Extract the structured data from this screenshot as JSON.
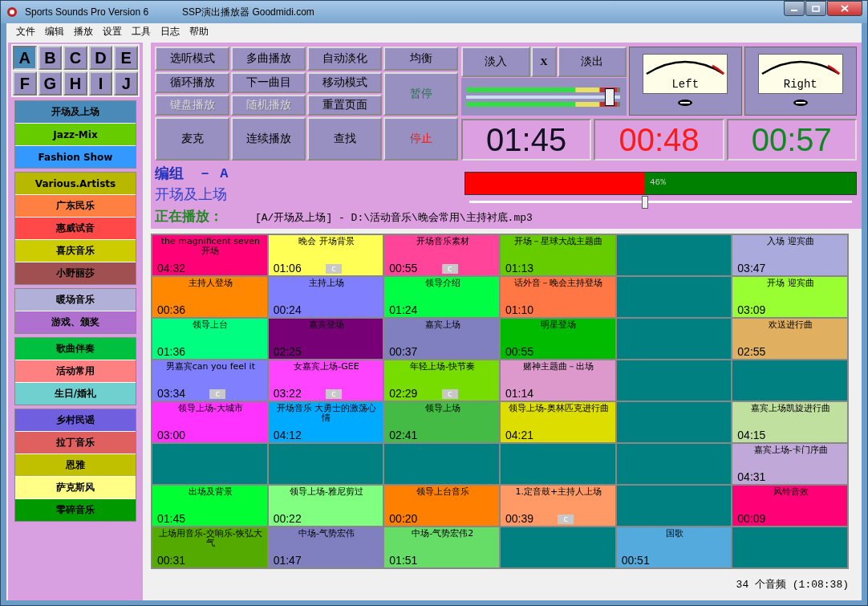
{
  "window": {
    "title": "Sports Sounds Pro Version 6",
    "subtitle": "SSP演出播放器 Goodmidi.com"
  },
  "menu": [
    "文件",
    "编辑",
    "播放",
    "设置",
    "工具",
    "日志",
    "帮助"
  ],
  "letters": [
    {
      "label": "A",
      "selected": true
    },
    {
      "label": "B",
      "selected": false
    },
    {
      "label": "C",
      "selected": false
    },
    {
      "label": "D",
      "selected": false
    },
    {
      "label": "E",
      "selected": false
    },
    {
      "label": "F",
      "selected": false
    },
    {
      "label": "G",
      "selected": false
    },
    {
      "label": "H",
      "selected": false
    },
    {
      "label": "I",
      "selected": false
    },
    {
      "label": "J",
      "selected": false
    }
  ],
  "category_groups": [
    [
      {
        "label": "开场及上场",
        "color": "#4a8ab8"
      },
      {
        "label": "Jazz-Mix",
        "color": "#66cc00"
      },
      {
        "label": "Fashion Show",
        "color": "#3399ff"
      }
    ],
    [
      {
        "label": "Various.Artists",
        "color": "#b8b800"
      },
      {
        "label": "广东民乐",
        "color": "#ff8040"
      },
      {
        "label": "惠威试音",
        "color": "#ff4848"
      },
      {
        "label": "喜庆音乐",
        "color": "#cccc00"
      },
      {
        "label": "小野丽莎",
        "color": "#a05050"
      }
    ],
    [
      {
        "label": "暖场音乐",
        "color": "#b0b0d8"
      },
      {
        "label": "游戏、颁奖",
        "color": "#b070d0"
      }
    ],
    [
      {
        "label": "歌曲伴奏",
        "color": "#00c040"
      },
      {
        "label": "活动常用",
        "color": "#ff8080"
      },
      {
        "label": "生日/婚礼",
        "color": "#70d0d0"
      }
    ],
    [
      {
        "label": "乡村民谣",
        "color": "#7060e0"
      },
      {
        "label": "拉丁音乐",
        "color": "#e06060"
      },
      {
        "label": "恩雅",
        "color": "#c0c000"
      },
      {
        "label": "萨克斯风",
        "color": "#ffff88"
      },
      {
        "label": "零碎音乐",
        "color": "#009900"
      }
    ]
  ],
  "controls": [
    {
      "label": "选听模式",
      "kind": "normal",
      "disabled": false
    },
    {
      "label": "多曲播放",
      "kind": "normal",
      "disabled": false
    },
    {
      "label": "自动淡化",
      "kind": "normal",
      "disabled": false
    },
    {
      "label": "均衡",
      "kind": "normal",
      "disabled": false
    },
    {
      "label": "循环播放",
      "kind": "normal",
      "disabled": false
    },
    {
      "label": "下一曲目",
      "kind": "normal",
      "disabled": false
    },
    {
      "label": "移动模式",
      "kind": "normal",
      "disabled": false
    },
    {
      "label": "暂停",
      "kind": "pause",
      "disabled": false
    },
    {
      "label": "键盘播放",
      "kind": "normal",
      "disabled": true
    },
    {
      "label": "随机播放",
      "kind": "normal",
      "disabled": true
    },
    {
      "label": "重置页面",
      "kind": "normal",
      "disabled": false
    },
    {
      "label": "麦克",
      "kind": "big",
      "disabled": false
    },
    {
      "label": "连续播放",
      "kind": "big",
      "disabled": false
    },
    {
      "label": "查找",
      "kind": "big",
      "disabled": false
    },
    {
      "label": "停止",
      "kind": "stop",
      "disabled": false
    }
  ],
  "fade": {
    "fade_in": "淡入",
    "cross": "X",
    "fade_out": "淡出"
  },
  "level_meters": [
    {
      "level": 0.98
    },
    {
      "level": 0.98
    }
  ],
  "volume": {
    "level": 0.93
  },
  "vu_meters": [
    {
      "label": "Left"
    },
    {
      "label": "Right"
    }
  ],
  "times": [
    {
      "value": "01:45",
      "kind": "total"
    },
    {
      "value": "00:48",
      "kind": "elapsed"
    },
    {
      "value": "00:57",
      "kind": "remaining"
    }
  ],
  "group_label": "编组",
  "group_letter": "－ A",
  "category_name": "开场及上场",
  "progress": {
    "level": 0.46,
    "label": "46%"
  },
  "seek": {
    "level": 0.46
  },
  "now_playing": {
    "label": "正在播放：",
    "path": "[A/开场及上场] - D:\\活动音乐\\晚会常用\\主持衬底.mp3"
  },
  "grid": [
    [
      {
        "kind": "sound",
        "title": "the magnificent seven开场",
        "time": "04:32",
        "color": "#ff0077"
      },
      {
        "kind": "sound",
        "title": "晚会 开场背景",
        "time": "01:06",
        "badge": "c",
        "color": "#ffff55"
      },
      {
        "kind": "sound",
        "title": "开场音乐素材",
        "time": "00:55",
        "badge": "c",
        "color": "#ff4499"
      },
      {
        "kind": "sound",
        "title": "开场－星球大战主题曲",
        "time": "01:13",
        "color": "#66cc00"
      },
      {
        "kind": "empty"
      },
      {
        "kind": "sound",
        "title": "入场 迎宾曲",
        "time": "03:47",
        "color": "#aaaadd"
      }
    ],
    [
      {
        "kind": "sound",
        "title": "主持人登场",
        "time": "00:36",
        "color": "#ff8800"
      },
      {
        "kind": "sound",
        "title": "主持上场",
        "time": "00:24",
        "color": "#8080ff"
      },
      {
        "kind": "sound",
        "title": "领导介绍",
        "time": "01:24",
        "color": "#00ff44"
      },
      {
        "kind": "sound",
        "title": "话外音－晚会主持登场",
        "time": "01:10",
        "color": "#ff7744"
      },
      {
        "kind": "empty"
      },
      {
        "kind": "sound",
        "title": "开场 迎宾曲",
        "time": "03:09",
        "color": "#99ff33"
      }
    ],
    [
      {
        "kind": "sound",
        "title": "领导上台",
        "time": "01:36",
        "color": "#00ff80"
      },
      {
        "kind": "sound",
        "title": "嘉宾登场",
        "time": "02:25",
        "color": "#770077"
      },
      {
        "kind": "sound",
        "title": "嘉宾上场",
        "time": "00:37",
        "color": "#8080c0"
      },
      {
        "kind": "sound",
        "title": "明星登场",
        "time": "00:55",
        "color": "#00bb00"
      },
      {
        "kind": "empty"
      },
      {
        "kind": "sound",
        "title": "欢送进行曲",
        "time": "02:55",
        "color": "#e0b060"
      }
    ],
    [
      {
        "kind": "sound",
        "title": "男嘉宾can you feel it",
        "time": "03:34",
        "badge": "c",
        "color": "#8080ff"
      },
      {
        "kind": "sound",
        "title": "女嘉宾上场-GEE",
        "time": "03:22",
        "badge": "c",
        "color": "#ff44ff"
      },
      {
        "kind": "sound",
        "title": "年轻上场-快节奏",
        "time": "02:29",
        "badge": "c",
        "color": "#77dd00"
      },
      {
        "kind": "sound",
        "title": "赌神主题曲－出场",
        "time": "01:14",
        "color": "#dd99cc"
      },
      {
        "kind": "empty"
      },
      {
        "kind": "empty"
      }
    ],
    [
      {
        "kind": "sound",
        "title": "领导上场-大城市",
        "time": "03:00",
        "color": "#ff33ff"
      },
      {
        "kind": "sound",
        "title": "开场音乐 大勇士的激荡心情",
        "time": "04:12",
        "color": "#00aaff"
      },
      {
        "kind": "sound",
        "title": "领导上场",
        "time": "02:41",
        "color": "#44bb44"
      },
      {
        "kind": "sound",
        "title": "领导上场-奥林匹克进行曲",
        "time": "04:21",
        "color": "#dddd00"
      },
      {
        "kind": "empty"
      },
      {
        "kind": "sound",
        "title": "嘉宾上场凯旋进行曲",
        "time": "04:15",
        "color": "#c0e0a0"
      }
    ],
    [
      {
        "kind": "empty"
      },
      {
        "kind": "empty"
      },
      {
        "kind": "empty"
      },
      {
        "kind": "empty"
      },
      {
        "kind": "empty"
      },
      {
        "kind": "sound",
        "title": "嘉宾上场-卡门序曲",
        "time": "04:31",
        "color": "#c0a8d8"
      }
    ],
    [
      {
        "kind": "sound",
        "title": "出场及背景",
        "time": "01:45",
        "color": "#00ff33"
      },
      {
        "kind": "sound",
        "title": "领导上场-雅尼剪过",
        "time": "00:22",
        "color": "#80ff80"
      },
      {
        "kind": "sound",
        "title": "领导上台音乐",
        "time": "00:20",
        "color": "#ff8000"
      },
      {
        "kind": "sound",
        "title": "1.定音鼓+主持人上场",
        "time": "00:39",
        "badge": "c",
        "color": "#ff9966"
      },
      {
        "kind": "empty"
      },
      {
        "kind": "sound",
        "title": "风铃音效",
        "time": "00:09",
        "color": "#ff0077"
      }
    ],
    [
      {
        "kind": "sound",
        "title": "上场用音乐-交响乐-恢弘大气",
        "time": "00:31",
        "color": "#55aa00"
      },
      {
        "kind": "sound",
        "title": "中场-气势宏伟",
        "time": "01:47",
        "color": "#8080c0"
      },
      {
        "kind": "sound",
        "title": "中场-气势宏伟2",
        "time": "01:51",
        "color": "#66dd66"
      },
      {
        "kind": "empty"
      },
      {
        "kind": "sound",
        "title": "国歌",
        "time": "00:51",
        "color": "#55aadd"
      },
      {
        "kind": "empty"
      }
    ]
  ],
  "status_bar": "34 个音频 (1:08:38)"
}
